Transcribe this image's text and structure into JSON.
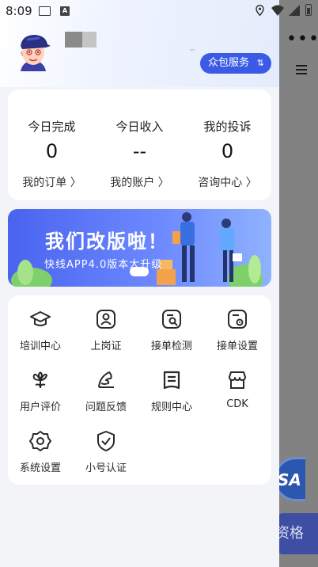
{
  "status_bar": {
    "time": "8:09",
    "icons": [
      "message-icon",
      "a-app-icon",
      "location-icon",
      "wifi-icon",
      "signal-icon",
      "battery-icon"
    ]
  },
  "background_app": {
    "button_label": "资格",
    "badge_text": "SA"
  },
  "profile": {
    "service_button": {
      "label": "众包服务",
      "icon": "swap-icon"
    }
  },
  "stats": [
    {
      "label": "今日完成",
      "value": "0",
      "link": "我的订单 〉"
    },
    {
      "label": "今日收入",
      "value": "--",
      "link": "我的账户 〉"
    },
    {
      "label": "我的投诉",
      "value": "0",
      "link": "咨询中心 〉"
    }
  ],
  "banner": {
    "title": "我们改版啦！",
    "subtitle": "快线APP4.0版本大升级"
  },
  "menu": [
    {
      "label": "培训中心",
      "icon": "graduation-cap-icon"
    },
    {
      "label": "上岗证",
      "icon": "id-badge-icon"
    },
    {
      "label": "接单检测",
      "icon": "search-doc-icon"
    },
    {
      "label": "接单设置",
      "icon": "settings-doc-icon"
    },
    {
      "label": "用户评价",
      "icon": "flower-icon"
    },
    {
      "label": "问题反馈",
      "icon": "feather-pen-icon"
    },
    {
      "label": "规则中心",
      "icon": "rules-icon"
    },
    {
      "label": "CDK",
      "icon": "shop-icon"
    },
    {
      "label": "系统设置",
      "icon": "gear-icon"
    },
    {
      "label": "小号认证",
      "icon": "shield-check-icon"
    }
  ],
  "colors": {
    "accent": "#3b5be6",
    "drawer_bg": "#f3f4f7",
    "card_bg": "#ffffff",
    "overlay": "#828282"
  }
}
